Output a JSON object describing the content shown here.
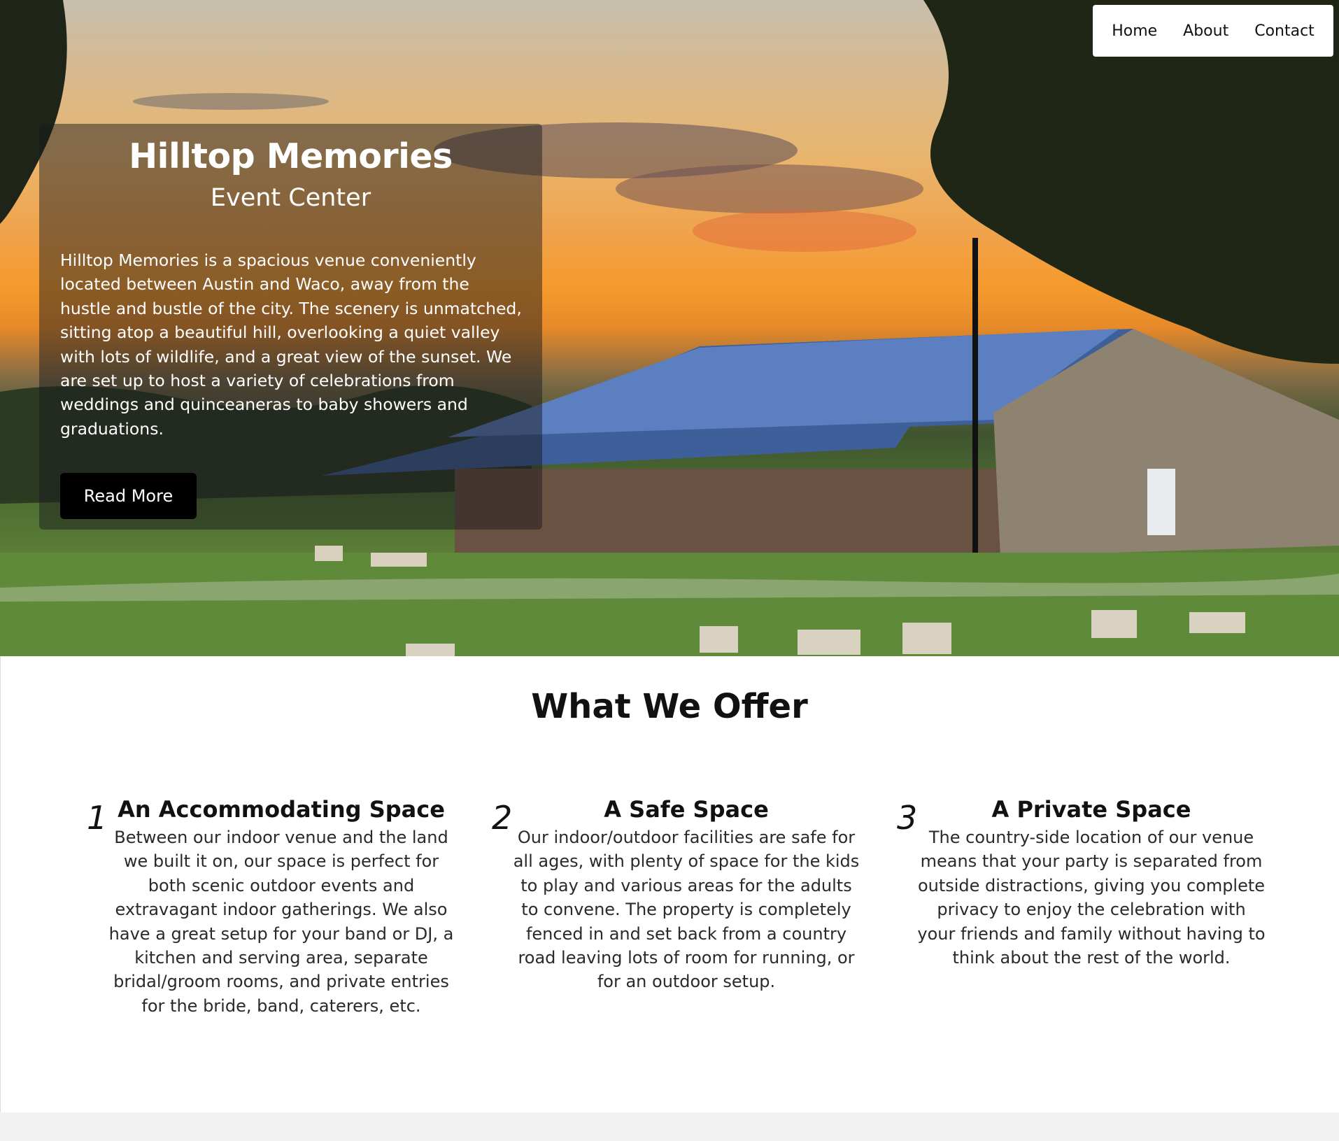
{
  "nav": {
    "items": [
      "Home",
      "About",
      "Contact"
    ]
  },
  "hero": {
    "title": "Hilltop Memories",
    "subtitle": "Event Center",
    "description": "Hilltop Memories is a spacious venue conveniently located between Austin and Waco, away from the hustle and bustle of the city. The scenery is unmatched, sitting atop a beautiful hill, overlooking a quiet valley with lots of wildlife, and a great view of the sunset. We are set up to host a variety of celebrations from weddings and quinceaneras to baby showers and graduations.",
    "button_label": "Read More"
  },
  "offer": {
    "title": "What We Offer",
    "features": [
      {
        "number": "1",
        "heading": "An Accommodating Space",
        "body": "Between our indoor venue and the land we built it on, our space is perfect for both scenic outdoor events and extravagant indoor gatherings. We also have a great setup for your band or DJ, a kitchen and serving area, separate bridal/groom rooms, and private entries for the bride, band, caterers, etc."
      },
      {
        "number": "2",
        "heading": "A Safe Space",
        "body": "Our indoor/outdoor facilities are safe for all ages, with plenty of space for the kids to play and various areas for the adults to convene. The property is completely fenced in and set back from a country road leaving lots of room for running, or for an outdoor setup."
      },
      {
        "number": "3",
        "heading": "A Private Space",
        "body": "The country-side location of our venue means that your party is separated from outside distractions, giving you complete privacy to enjoy the celebration with your friends and family without having to think about the rest of the world."
      }
    ]
  }
}
